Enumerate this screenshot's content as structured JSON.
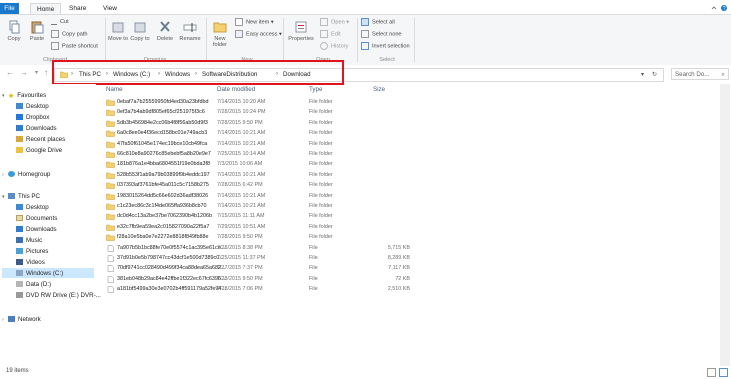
{
  "tabs": {
    "file": "File",
    "home": "Home",
    "share": "Share",
    "view": "View"
  },
  "ribbon": {
    "clipboard": {
      "copy": "Copy",
      "paste": "Paste",
      "cut": "Cut",
      "copy_path": "Copy path",
      "paste_shortcut": "Paste shortcut",
      "label": "Clipboard"
    },
    "organize": {
      "move_to": "Move to",
      "copy_to": "Copy to",
      "delete": "Delete",
      "rename": "Rename",
      "label": "Organize"
    },
    "new": {
      "new_folder": "New folder",
      "new_item": "New item",
      "easy_access": "Easy access",
      "label": "New"
    },
    "open": {
      "properties": "Properties",
      "open": "Open",
      "edit": "Edit",
      "history": "History",
      "label": "Open"
    },
    "select": {
      "select_all": "Select all",
      "select_none": "Select none",
      "invert": "Invert selection",
      "label": "Select"
    }
  },
  "address": {
    "crumbs": [
      "This PC",
      "Windows (C:)",
      "Windows",
      "SoftwareDistribution",
      "Download"
    ],
    "search_placeholder": "Search Do..."
  },
  "nav": {
    "favourites": "Favourites",
    "fav_items": [
      "Desktop",
      "Dropbox",
      "Downloads",
      "Recent places",
      "Google Drive"
    ],
    "homegroup": "Homegroup",
    "this_pc": "This PC",
    "pc_items": [
      "Desktop",
      "Documents",
      "Downloads",
      "Music",
      "Pictures",
      "Videos",
      "Windows (C:)",
      "Data (D:)",
      "DVD RW Drive (E:) DVR-..."
    ],
    "network": "Network"
  },
  "columns": {
    "name": "Name",
    "date": "Date modified",
    "type": "Type",
    "size": "Size"
  },
  "files": [
    {
      "name": "0ebaf7a7b25559950fd4ed30a23bfdbd",
      "date": "7/14/2015 10:20 AM",
      "type": "File folder",
      "size": "",
      "folder": true
    },
    {
      "name": "0ef3a7b4ab9df805ef65cf251975f3c6",
      "date": "7/28/2015 10:24 PM",
      "type": "File folder",
      "size": "",
      "folder": true
    },
    {
      "name": "5db3b456984e2cc06b4f8f56ab50d9f3",
      "date": "7/28/2015 9:50 PM",
      "type": "File folder",
      "size": "",
      "folder": true
    },
    {
      "name": "6a0c8ee0e4f36ecd158bc01e749acb3",
      "date": "7/14/2015 10:21 AM",
      "type": "File folder",
      "size": "",
      "folder": true
    },
    {
      "name": "47fa50f61045e174ec19bce10cb49fca",
      "date": "7/14/2015 10:21 AM",
      "type": "File folder",
      "size": "",
      "folder": true
    },
    {
      "name": "66c810e8a90276c85ebebf5a8b20e9e7",
      "date": "7/25/2015 10:14 AM",
      "type": "File folder",
      "size": "",
      "folder": true
    },
    {
      "name": "181b876a1e4bba6804551f19e0bda3f8",
      "date": "7/3/2015 10:06 AM",
      "type": "File folder",
      "size": "",
      "folder": true
    },
    {
      "name": "528b553f1ab9a79b03899f9b4eddc197",
      "date": "7/14/2015 10:21 AM",
      "type": "File folder",
      "size": "",
      "folder": true
    },
    {
      "name": "037393af3761bfe45a011c5c7158b275",
      "date": "7/28/2015 6:42 PM",
      "type": "File folder",
      "size": "",
      "folder": true
    },
    {
      "name": "1983015264dd5c66e602d36adf38026",
      "date": "7/14/2015 10:21 AM",
      "type": "File folder",
      "size": "",
      "folder": true
    },
    {
      "name": "c1c23ec86c3c1f4de065ffa936b8cb70",
      "date": "7/14/2015 10:21 AM",
      "type": "File folder",
      "size": "",
      "folder": true
    },
    {
      "name": "dc0d4cc13a2be37be7062390b4b1206b",
      "date": "7/15/2015 11:11 AM",
      "type": "File folder",
      "size": "",
      "folder": true
    },
    {
      "name": "e32c7fb9ea59ea2c015827090a22f5a7",
      "date": "7/29/2015 10:51 AM",
      "type": "File folder",
      "size": "",
      "folder": true
    },
    {
      "name": "f28a10e5ba0e7e2272e8818f849fb88e",
      "date": "7/28/2015 9:50 PM",
      "type": "File folder",
      "size": "",
      "folder": true
    },
    {
      "name": "7a907b5b1bc88fe70e0f5574c1ac395e61ce...",
      "date": "7/28/2015 8:38 PM",
      "type": "File",
      "size": "5,715 KB",
      "folder": false
    },
    {
      "name": "37d91b0e5b798747cc43dcf1e500d7389c0...",
      "date": "7/25/2015 11:37 PM",
      "type": "File",
      "size": "8,289 KB",
      "folder": false
    },
    {
      "name": "70df9741cc028490d499f34ca88dea65a682...",
      "date": "7/27/2015 7:37 PM",
      "type": "File",
      "size": "7,117 KB",
      "folder": false
    },
    {
      "name": "381eb048b29ac84e42ffbe1f322ec67fc6396...",
      "date": "7/28/2015 9:50 PM",
      "type": "File",
      "size": "72 KB",
      "folder": false
    },
    {
      "name": "a181bf5499a30e3e0702b4ff591179a52fe94...",
      "date": "7/28/2015 7:06 PM",
      "type": "File",
      "size": "2,510 KB",
      "folder": false
    }
  ],
  "status": {
    "count": "19 items"
  }
}
